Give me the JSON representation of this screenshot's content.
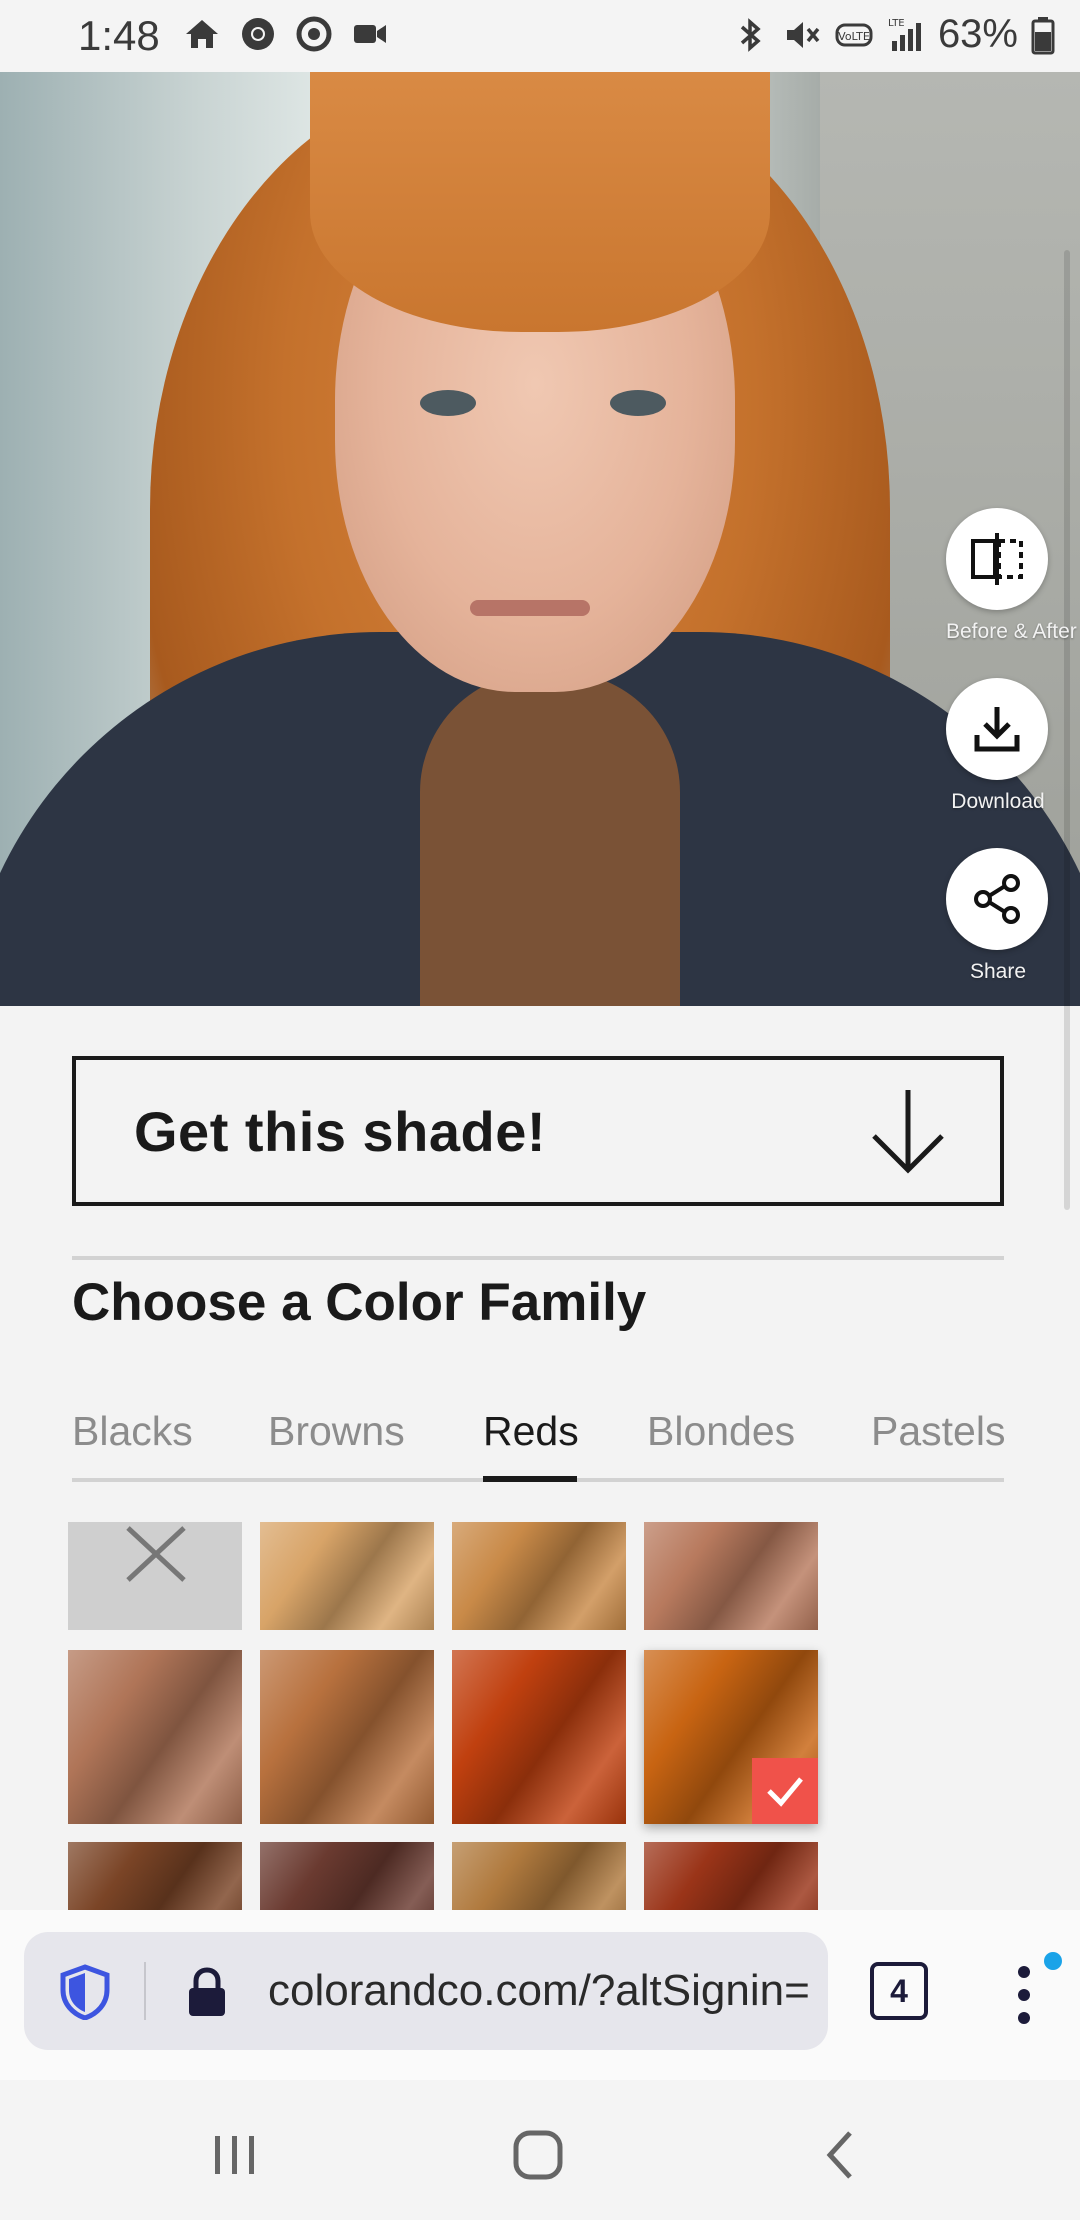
{
  "status_bar": {
    "time": "1:48",
    "battery": "63%",
    "left_icons": [
      "home-icon",
      "chrome-icon",
      "record-icon",
      "video-icon"
    ],
    "right_icons": [
      "bluetooth-icon",
      "mute-icon",
      "volte-icon",
      "signal-icon",
      "battery-icon"
    ]
  },
  "actions": {
    "before_after": "Before & After",
    "download": "Download",
    "share": "Share"
  },
  "get_shade": {
    "label": "Get this shade!"
  },
  "color_family": {
    "title": "Choose a Color Family"
  },
  "tabs": [
    {
      "label": "Blacks",
      "active": false
    },
    {
      "label": "Browns",
      "active": false
    },
    {
      "label": "Reds",
      "active": true
    },
    {
      "label": "Blondes",
      "active": false
    },
    {
      "label": "Pastels",
      "active": false
    }
  ],
  "swatches": {
    "selected_index": 7,
    "colors": [
      "none",
      "#d8a468",
      "#c98a48",
      "#b87a5e",
      "#b07558",
      "#b8713e",
      "#c0400f",
      "#c86412",
      "#7a4426",
      "#6a3a30",
      "#b07a3e",
      "#9a3418"
    ]
  },
  "browser": {
    "url": "colorandco.com/?altSignin=",
    "tab_count": "4",
    "accent": "#1c1b3a"
  }
}
